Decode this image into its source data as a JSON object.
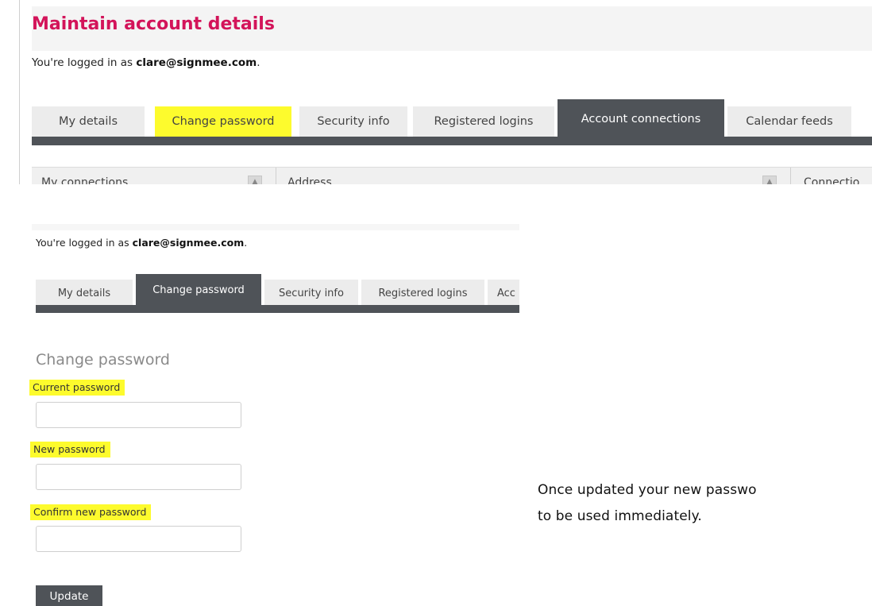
{
  "top_screenshot": {
    "title": "Maintain account details",
    "logged_in_prefix": "You're logged in as ",
    "logged_in_email": "clare@signmee.com",
    "logged_in_suffix": ".",
    "tabs": [
      {
        "label": "My details",
        "state": "default"
      },
      {
        "label": "Change password",
        "state": "highlighted"
      },
      {
        "label": "Security info",
        "state": "default"
      },
      {
        "label": "Registered logins",
        "state": "default"
      },
      {
        "label": "Account connections",
        "state": "active"
      },
      {
        "label": "Calendar feeds",
        "state": "default"
      }
    ],
    "grid_columns": [
      "My connections",
      "Address",
      "Connectio"
    ]
  },
  "bottom_screenshot": {
    "logged_in_prefix": "You're logged in as ",
    "logged_in_email": "clare@signmee.com",
    "logged_in_suffix": ".",
    "tabs": [
      {
        "label": "My details",
        "state": "default"
      },
      {
        "label": "Change password",
        "state": "active"
      },
      {
        "label": "Security info",
        "state": "default"
      },
      {
        "label": "Registered logins",
        "state": "default"
      },
      {
        "label": "Acc",
        "state": "default"
      }
    ],
    "form": {
      "heading": "Change password",
      "fields": [
        {
          "label": "Current password",
          "value": ""
        },
        {
          "label": "New password",
          "value": ""
        },
        {
          "label": "Confirm new password",
          "value": ""
        }
      ],
      "submit_label": "Update"
    }
  },
  "note": {
    "line1": "Once updated your new passwo",
    "line2": "to be used immediately."
  },
  "colors": {
    "title_pink": "#d3145a",
    "tab_active_dark": "#4f5358",
    "highlight_yellow": "#fdfb2d",
    "tab_default_bg": "#ececec"
  }
}
